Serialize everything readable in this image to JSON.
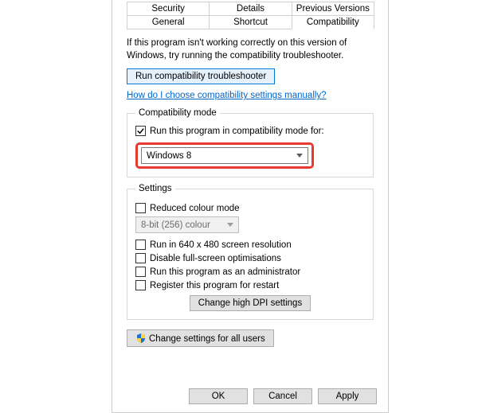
{
  "tabs": {
    "row1": [
      "Security",
      "Details",
      "Previous Versions"
    ],
    "row2": [
      "General",
      "Shortcut",
      "Compatibility"
    ],
    "active": "Compatibility"
  },
  "intro": "If this program isn't working correctly on this version of Windows, try running the compatibility troubleshooter.",
  "troubleshooter_btn": "Run compatibility troubleshooter",
  "manual_link": "How do I choose compatibility settings manually?",
  "compat_mode": {
    "legend": "Compatibility mode",
    "checkbox_label": "Run this program in compatibility mode for:",
    "checkbox_checked": true,
    "selected": "Windows 8"
  },
  "settings": {
    "legend": "Settings",
    "reduced_colour": {
      "label": "Reduced colour mode",
      "checked": false
    },
    "colour_select": "8-bit (256) colour",
    "run_640": {
      "label": "Run in 640 x 480 screen resolution",
      "checked": false
    },
    "disable_fullscreen": {
      "label": "Disable full-screen optimisations",
      "checked": false
    },
    "run_admin": {
      "label": "Run this program as an administrator",
      "checked": false
    },
    "register_restart": {
      "label": "Register this program for restart",
      "checked": false
    },
    "dpi_btn": "Change high DPI settings"
  },
  "all_users_btn": "Change settings for all users",
  "footer": {
    "ok": "OK",
    "cancel": "Cancel",
    "apply": "Apply"
  }
}
